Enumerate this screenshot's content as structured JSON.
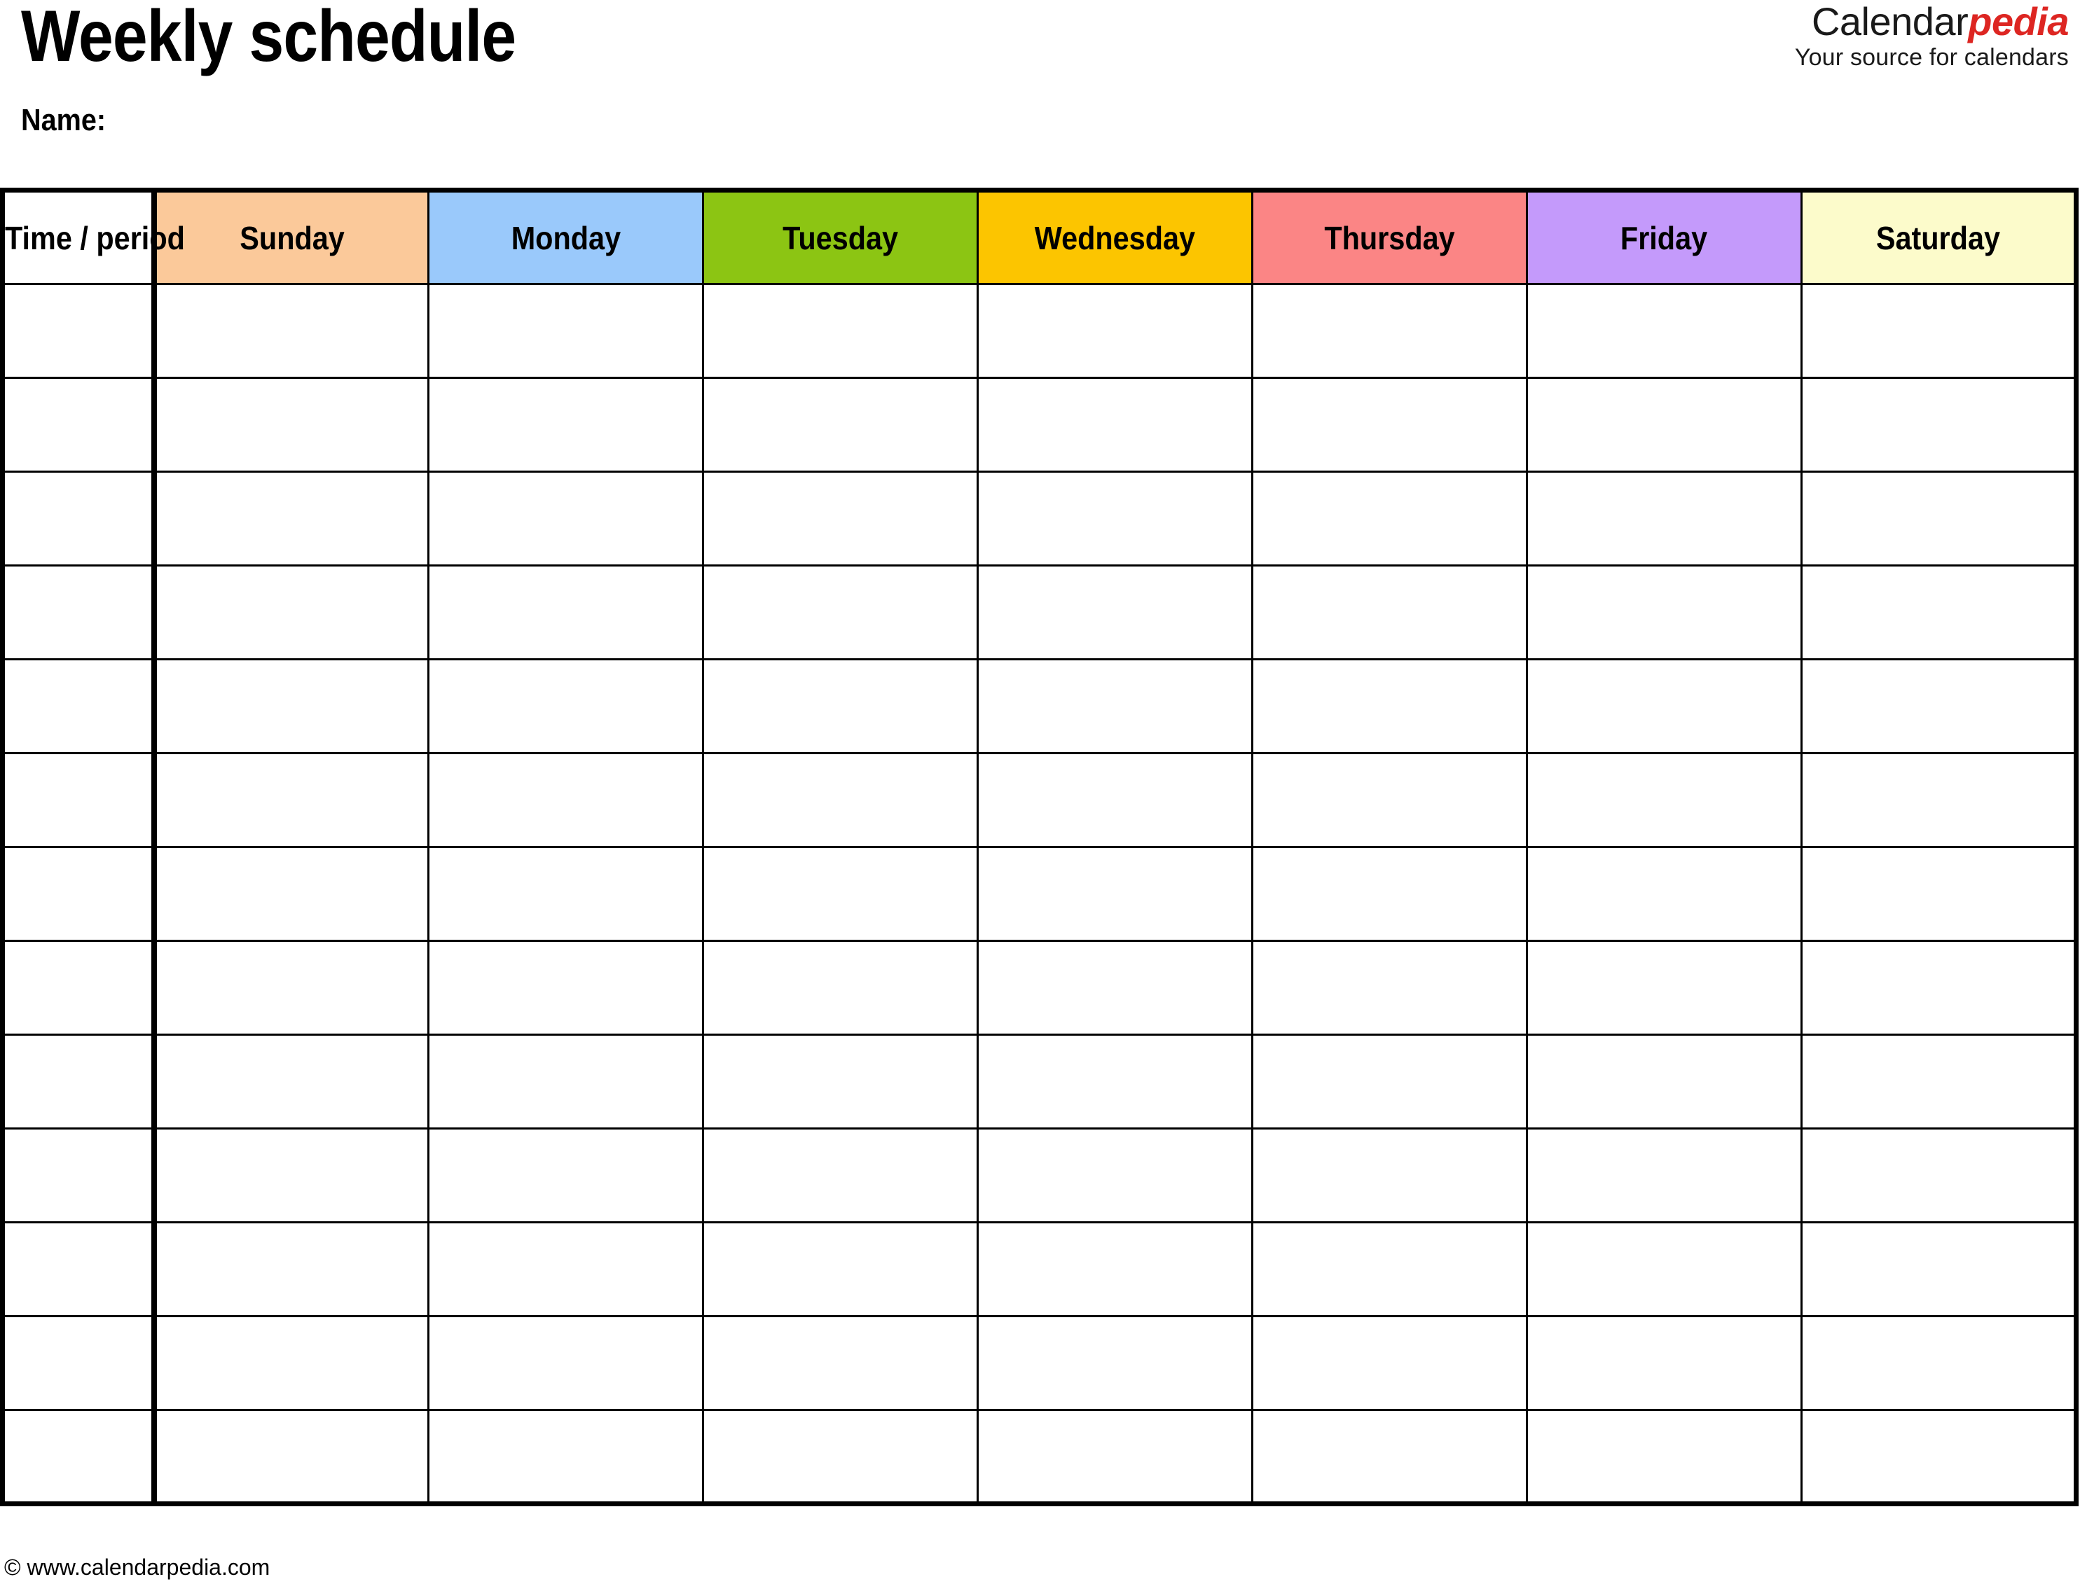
{
  "document": {
    "title": "Weekly schedule",
    "name_label": "Name:"
  },
  "brand": {
    "word_1": "Calendar",
    "word_2": "pedia",
    "tagline": "Your source for calendars",
    "accent_color": "#dd2622",
    "text_color": "#1a1a1a"
  },
  "table": {
    "time_column_header": "Time / period",
    "day_headers": [
      {
        "label": "Sunday",
        "color": "#fbc99a"
      },
      {
        "label": "Monday",
        "color": "#9ac9fb"
      },
      {
        "label": "Tuesday",
        "color": "#8cc513"
      },
      {
        "label": "Wednesday",
        "color": "#fcc500"
      },
      {
        "label": "Thursday",
        "color": "#fb8585"
      },
      {
        "label": "Friday",
        "color": "#c49afb"
      },
      {
        "label": "Saturday",
        "color": "#fcfbcb"
      }
    ],
    "row_count": 13,
    "rows": [
      {
        "time": "",
        "cells": [
          "",
          "",
          "",
          "",
          "",
          "",
          ""
        ]
      },
      {
        "time": "",
        "cells": [
          "",
          "",
          "",
          "",
          "",
          "",
          ""
        ]
      },
      {
        "time": "",
        "cells": [
          "",
          "",
          "",
          "",
          "",
          "",
          ""
        ]
      },
      {
        "time": "",
        "cells": [
          "",
          "",
          "",
          "",
          "",
          "",
          ""
        ]
      },
      {
        "time": "",
        "cells": [
          "",
          "",
          "",
          "",
          "",
          "",
          ""
        ]
      },
      {
        "time": "",
        "cells": [
          "",
          "",
          "",
          "",
          "",
          "",
          ""
        ]
      },
      {
        "time": "",
        "cells": [
          "",
          "",
          "",
          "",
          "",
          "",
          ""
        ]
      },
      {
        "time": "",
        "cells": [
          "",
          "",
          "",
          "",
          "",
          "",
          ""
        ]
      },
      {
        "time": "",
        "cells": [
          "",
          "",
          "",
          "",
          "",
          "",
          ""
        ]
      },
      {
        "time": "",
        "cells": [
          "",
          "",
          "",
          "",
          "",
          "",
          ""
        ]
      },
      {
        "time": "",
        "cells": [
          "",
          "",
          "",
          "",
          "",
          "",
          ""
        ]
      },
      {
        "time": "",
        "cells": [
          "",
          "",
          "",
          "",
          "",
          "",
          ""
        ]
      },
      {
        "time": "",
        "cells": [
          "",
          "",
          "",
          "",
          "",
          "",
          ""
        ]
      }
    ]
  },
  "footer": {
    "copyright": "© www.calendarpedia.com"
  }
}
